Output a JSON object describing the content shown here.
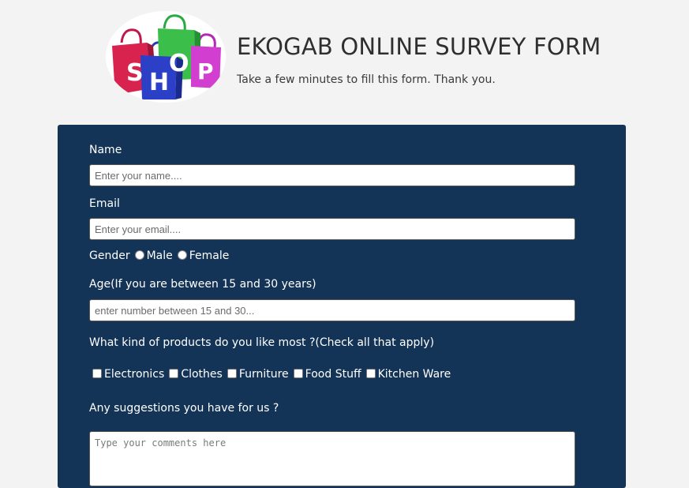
{
  "header": {
    "title": "EKOGAB ONLINE SURVEY FORM",
    "subtitle": "Take a few minutes to fill this form. Thank you.",
    "logo_text": "SHOP"
  },
  "form": {
    "name": {
      "label": "Name",
      "placeholder": "Enter your name...."
    },
    "email": {
      "label": "Email",
      "placeholder": "Enter your email...."
    },
    "gender": {
      "label": "Gender",
      "options": [
        "Male",
        "Female"
      ]
    },
    "age": {
      "label": "Age(If you are between 15 and 30 years)",
      "placeholder": "enter number between 15 and 30..."
    },
    "products": {
      "label": "What kind of products do you like most ?(Check all that apply)",
      "options": [
        "Electronics",
        "Clothes",
        "Furniture",
        "Food Stuff",
        "Kitchen Ware"
      ]
    },
    "suggestions": {
      "label": "Any suggestions you have for us ?",
      "placeholder": "Type your comments here"
    }
  },
  "colors": {
    "page_background": "#f3f3f3",
    "form_background": "#143457",
    "title_text": "#2f2f2f"
  }
}
